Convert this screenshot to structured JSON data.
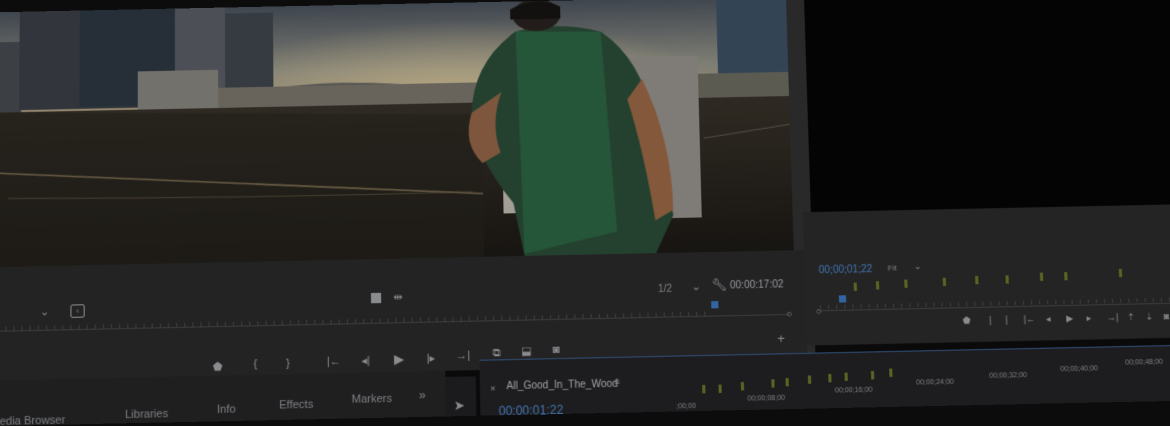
{
  "source_monitor": {
    "zoom": "1/2",
    "timecode": "00:00:17:02"
  },
  "program_monitor": {
    "timecode": "00;00;01;22",
    "fit_label": "Fit"
  },
  "panel_tabs": [
    "Media Browser",
    "Libraries",
    "Info",
    "Effects",
    "Markers"
  ],
  "overflow_label": "»",
  "timeline": {
    "sequence_name": "All_Good_In_The_Wood",
    "timecode": "00:00:01:22",
    "ruler_labels": [
      ";00;00",
      "00;00;08;00",
      "00;00;16;00",
      "00;00;24;00",
      "00;00;32;00",
      "00;00;40;00",
      "00;00;48;00"
    ]
  },
  "icons": {
    "dropdown": "chevron-down-icon",
    "wrench": "wrench-icon",
    "marker": "add-marker-icon",
    "in": "mark-in-icon",
    "out": "mark-out-icon",
    "go_in": "go-to-in-icon",
    "step_back": "step-back-icon",
    "play": "play-icon",
    "step_fwd": "step-forward-icon",
    "go_out": "go-to-out-icon",
    "insert": "insert-icon",
    "overwrite": "overwrite-icon",
    "export_frame": "camera-icon",
    "add": "plus-icon",
    "selection": "selection-tool-icon"
  },
  "colors": {
    "accent_blue": "#3e7bc6",
    "marker_yellow": "#6f7a2a",
    "panel": "#2b2b2d"
  }
}
